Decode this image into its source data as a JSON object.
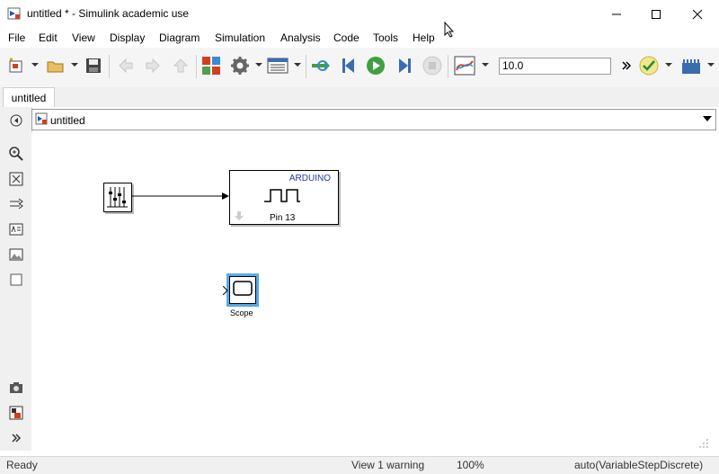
{
  "window": {
    "title": "untitled * - Simulink academic use"
  },
  "menu": [
    "File",
    "Edit",
    "View",
    "Display",
    "Diagram",
    "Simulation",
    "Analysis",
    "Code",
    "Tools",
    "Help"
  ],
  "toolbar": {
    "stop_time": "10.0"
  },
  "tab": {
    "label": "untitled"
  },
  "address": {
    "path": "untitled"
  },
  "blocks": {
    "arduino_header": "ARDUINO",
    "arduino_pin": "Pin 13",
    "scope_label": "Scope"
  },
  "status": {
    "left": "Ready",
    "warning": "View 1 warning",
    "zoom": "100%",
    "solver": "auto(VariableStepDiscrete)"
  },
  "colors": {
    "accent": "#1e5aa8",
    "selection": "#5aa9e6"
  }
}
